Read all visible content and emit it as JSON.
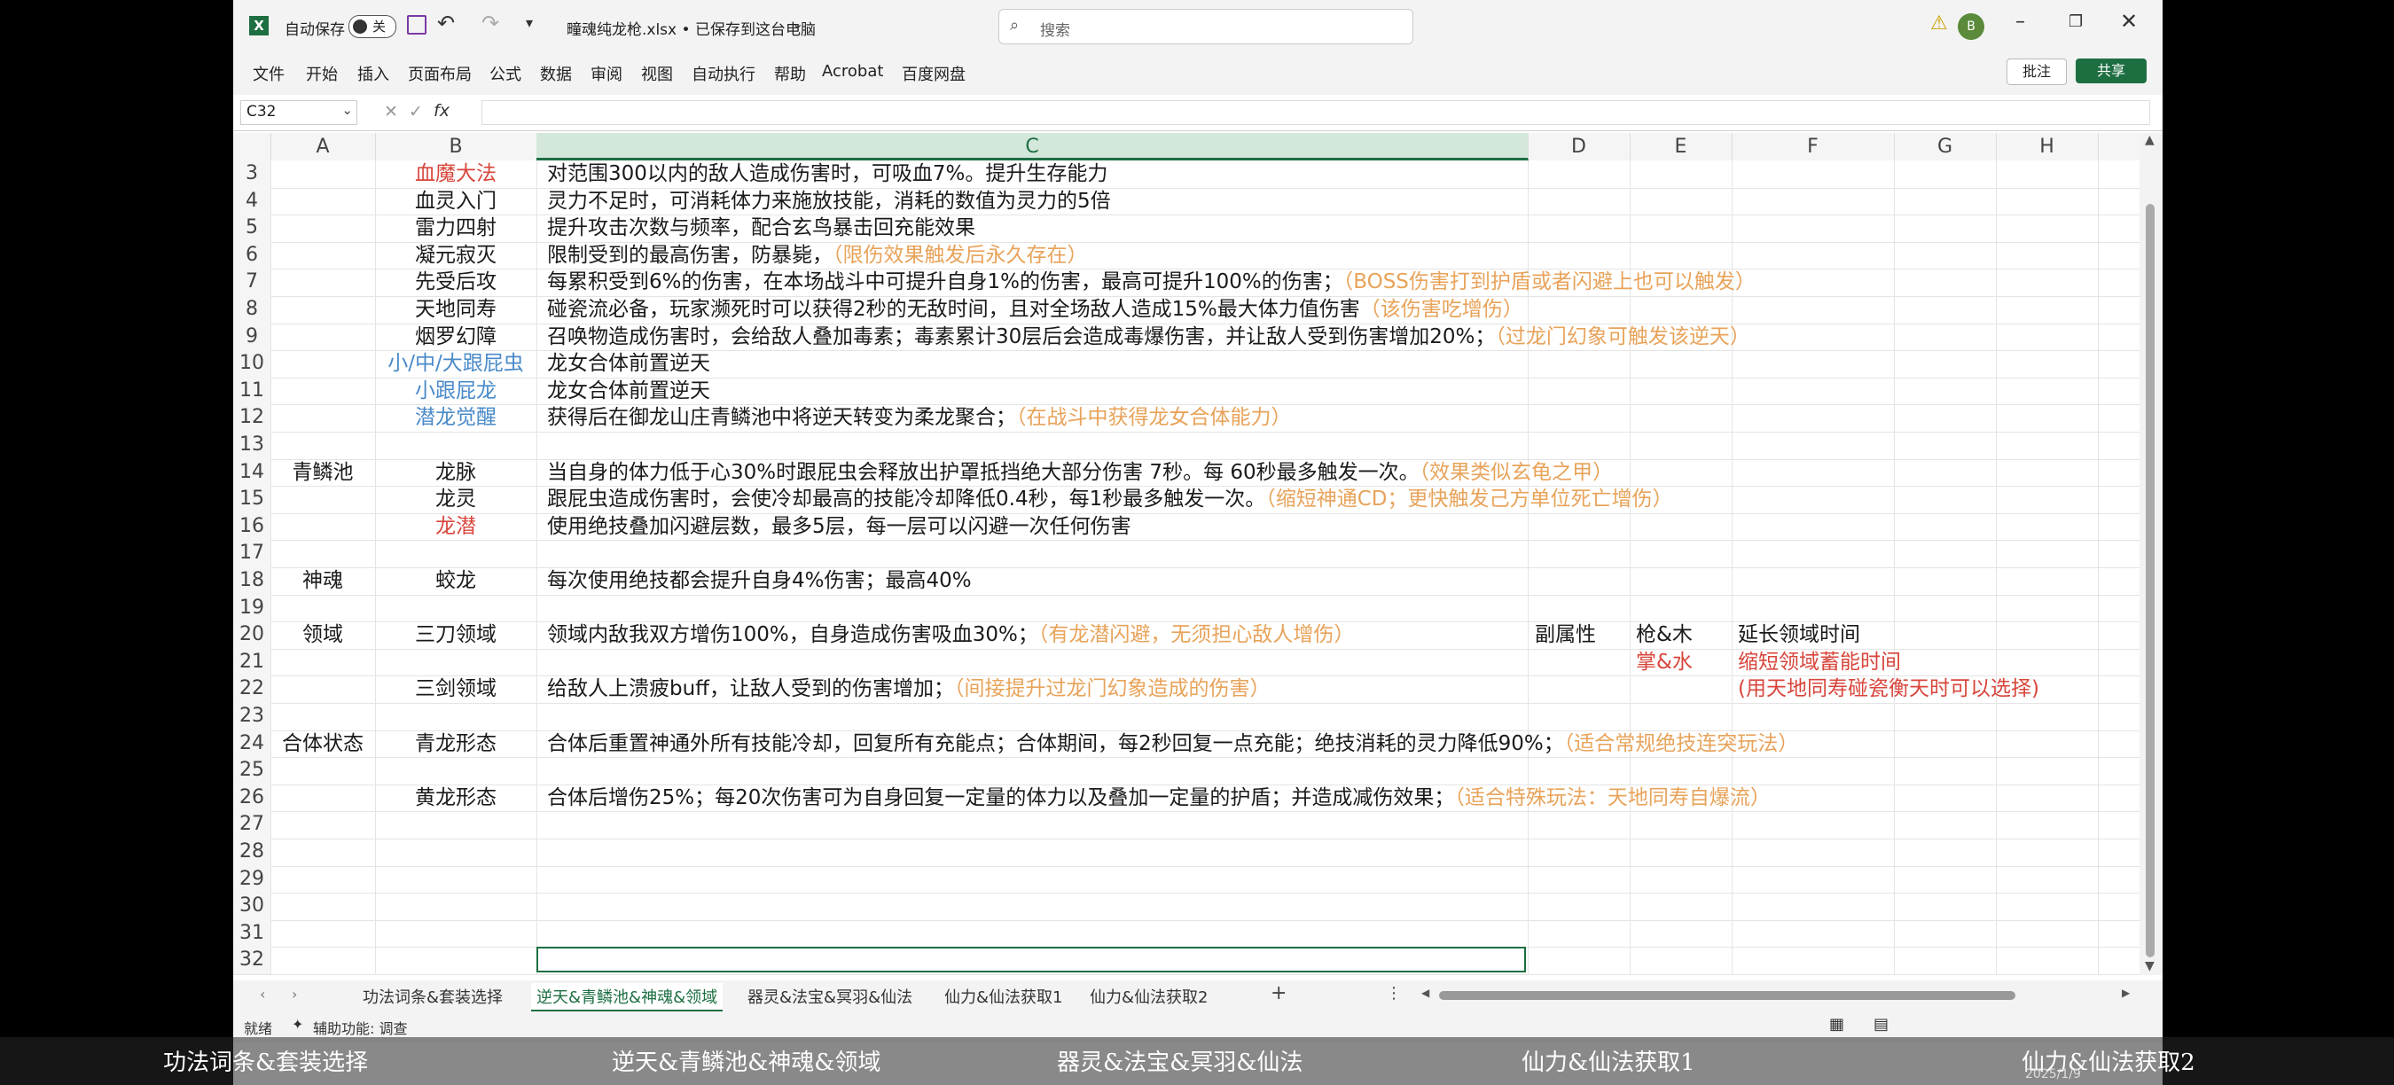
{
  "titlebar": {
    "autosave_label": "自动保存",
    "toggle_state": "关",
    "file_title": "疃魂纯龙枪.xlsx • 已保存到这台电脑",
    "search_placeholder": "搜索",
    "avatar_letter": "B"
  },
  "menu": [
    "文件",
    "开始",
    "插入",
    "页面布局",
    "公式",
    "数据",
    "审阅",
    "视图",
    "自动执行",
    "帮助",
    "Acrobat",
    "百度网盘"
  ],
  "ribbon_right": {
    "comment": "批注",
    "share": "共享"
  },
  "formula_bar": {
    "name_box": "C32",
    "fx": "fx",
    "value": ""
  },
  "columns": [
    "A",
    "B",
    "C",
    "D",
    "E",
    "F",
    "G",
    "H"
  ],
  "rows": [
    {
      "n": "3",
      "b": "血魔大法",
      "b_style": "red",
      "c": "对范围300以内的敌人造成伤害时，可吸血7%。提升生存能力",
      "c_note": ""
    },
    {
      "n": "4",
      "b": "血灵入门",
      "c": "灵力不足时，可消耗体力来施放技能，消耗的数值为灵力的5倍",
      "c_note": ""
    },
    {
      "n": "5",
      "b": "雷力四射",
      "c": "提升攻击次数与频率，配合玄鸟暴击回充能效果",
      "c_note": ""
    },
    {
      "n": "6",
      "b": "凝元寂灭",
      "c": "限制受到的最高伤害，防暴毙，",
      "c_note": "（限伤效果触发后永久存在）"
    },
    {
      "n": "7",
      "b": "先受后攻",
      "c": "每累积受到6%的伤害，在本场战斗中可提升自身1%的伤害，最高可提升100%的伤害；",
      "c_note": "（BOSS伤害打到护盾或者闪避上也可以触发）"
    },
    {
      "n": "8",
      "b": "天地同寿",
      "c": "碰瓷流必备，玩家濒死时可以获得2秒的无敌时间，且对全场敌人造成15%最大体力值伤害",
      "c_note": "（该伤害吃增伤）"
    },
    {
      "n": "9",
      "b": "烟罗幻障",
      "c": "召唤物造成伤害时，会给敌人叠加毒素；毒素累计30层后会造成毒爆伤害，并让敌人受到伤害增加20%；",
      "c_note": "（过龙门幻象可触发该逆天）"
    },
    {
      "n": "10",
      "b": "小/中/大跟屁虫",
      "b_style": "blue",
      "c": "龙女合体前置逆天",
      "c_note": ""
    },
    {
      "n": "11",
      "b": "小跟屁龙",
      "b_style": "blue",
      "c": "龙女合体前置逆天",
      "c_note": ""
    },
    {
      "n": "12",
      "b": "潜龙觉醒",
      "b_style": "blue",
      "c": "获得后在御龙山庄青鳞池中将逆天转变为柔龙聚合；",
      "c_note": "（在战斗中获得龙女合体能力）"
    },
    {
      "n": "13",
      "b": "",
      "c": "",
      "c_note": ""
    },
    {
      "n": "14",
      "a": "青鳞池",
      "b": "龙脉",
      "c": "当自身的体力低于心30%时跟屁虫会释放出护罩抵挡绝大部分伤害 7秒。每 60秒最多触发一次。",
      "c_note": "（效果类似玄龟之甲）"
    },
    {
      "n": "15",
      "b": "龙灵",
      "c": "跟屁虫造成伤害时，会使冷却最高的技能冷却降低0.4秒，每1秒最多触发一次。",
      "c_note": "（缩短神通CD；更快触发己方单位死亡增伤）"
    },
    {
      "n": "16",
      "b": "龙潜",
      "b_style": "red",
      "c": "使用绝技叠加闪避层数，最多5层，每一层可以闪避一次任何伤害",
      "c_note": ""
    },
    {
      "n": "17",
      "b": "",
      "c": "",
      "c_note": ""
    },
    {
      "n": "18",
      "a": "神魂",
      "b": "蛟龙",
      "c": "每次使用绝技都会提升自身4%伤害；最高40%",
      "c_note": ""
    },
    {
      "n": "19",
      "b": "",
      "c": "",
      "c_note": ""
    },
    {
      "n": "20",
      "a": "领域",
      "b": "三刀领域",
      "c": "领域内敌我双方增伤100%，自身造成伤害吸血30%；",
      "c_note": "（有龙潜闪避，无须担心敌人增伤）",
      "d": "副属性",
      "e": "枪&木",
      "f": "延长领域时间"
    },
    {
      "n": "21",
      "b": "",
      "c": "",
      "c_note": "",
      "e": "掌&水",
      "e_style": "red",
      "f": "缩短领域蓄能时间",
      "f_style": "red"
    },
    {
      "n": "22",
      "b": "三剑领域",
      "c": "给敌人上溃疲buff，让敌人受到的伤害增加；",
      "c_note": "（间接提升过龙门幻象造成的伤害）",
      "f": "(用天地同寿碰瓷衡天时可以选择)",
      "f_style": "red"
    },
    {
      "n": "23",
      "b": "",
      "c": "",
      "c_note": ""
    },
    {
      "n": "24",
      "a": "合体状态",
      "b": "青龙形态",
      "c": "合体后重置神通外所有技能冷却，回复所有充能点；合体期间，每2秒回复一点充能；绝技消耗的灵力降低90%；",
      "c_note": "（适合常规绝技连突玩法）"
    },
    {
      "n": "25",
      "b": "",
      "c": "",
      "c_note": ""
    },
    {
      "n": "26",
      "b": "黄龙形态",
      "c": "合体后增伤25%；每20次伤害可为自身回复一定量的体力以及叠加一定量的护盾；并造成减伤效果；",
      "c_note": "（适合特殊玩法：天地同寿自爆流）"
    },
    {
      "n": "27",
      "b": "",
      "c": "",
      "c_note": ""
    },
    {
      "n": "28",
      "b": "",
      "c": "",
      "c_note": ""
    },
    {
      "n": "29",
      "b": "",
      "c": "",
      "c_note": ""
    },
    {
      "n": "30",
      "b": "",
      "c": "",
      "c_note": ""
    },
    {
      "n": "31",
      "b": "",
      "c": "",
      "c_note": ""
    },
    {
      "n": "32",
      "b": "",
      "c": "",
      "c_note": ""
    }
  ],
  "sheet_tabs": [
    "功法词条&套装选择",
    "逆天&青鳞池&神魂&领域",
    "器灵&法宝&冥羽&仙法",
    "仙力&仙法获取1",
    "仙力&仙法获取2"
  ],
  "active_tab_index": 1,
  "status": {
    "ready": "就绪",
    "accessibility": "辅助功能: 调查"
  },
  "taskbar_labels": [
    "功法词条&套装选择",
    "逆天&青鳞池&神魂&领域",
    "器灵&法宝&冥羽&仙法",
    "仙力&仙法获取1",
    "仙力&仙法获取2"
  ],
  "taskbar_date": "2025/1/9",
  "colors": {
    "excel_green": "#1d6f42",
    "note_orange": "#e8a35a",
    "red_text": "#d8463c",
    "blue_text": "#4a8ac8"
  }
}
